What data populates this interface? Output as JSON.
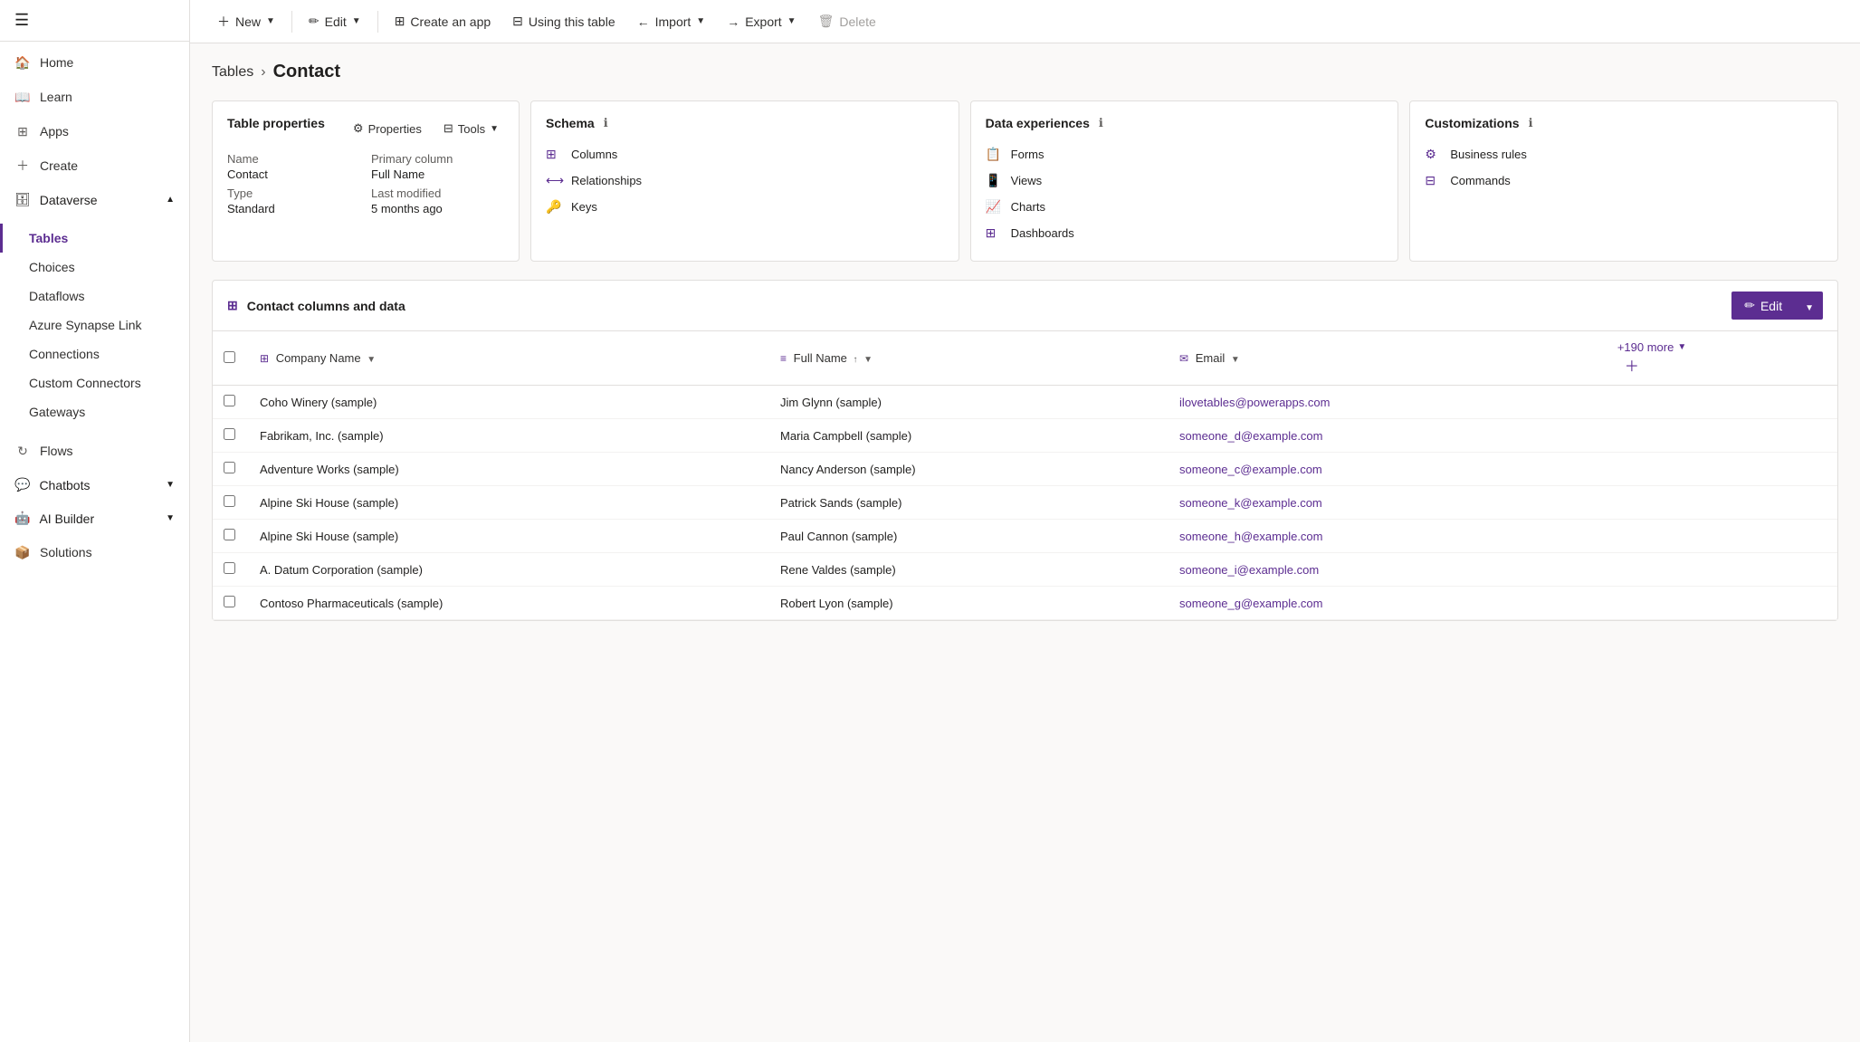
{
  "sidebar": {
    "items": [
      {
        "id": "home",
        "label": "Home",
        "icon": "🏠"
      },
      {
        "id": "learn",
        "label": "Learn",
        "icon": "📖"
      },
      {
        "id": "apps",
        "label": "Apps",
        "icon": "⊞"
      },
      {
        "id": "create",
        "label": "Create",
        "icon": "+"
      },
      {
        "id": "dataverse",
        "label": "Dataverse",
        "icon": "🗄",
        "expandable": true,
        "expanded": true
      }
    ],
    "dataverse_children": [
      {
        "id": "tables",
        "label": "Tables",
        "active": true
      },
      {
        "id": "choices",
        "label": "Choices"
      },
      {
        "id": "dataflows",
        "label": "Dataflows"
      },
      {
        "id": "azure-synapse-link",
        "label": "Azure Synapse Link"
      },
      {
        "id": "connections",
        "label": "Connections"
      },
      {
        "id": "custom-connectors",
        "label": "Custom Connectors"
      },
      {
        "id": "gateways",
        "label": "Gateways"
      }
    ],
    "bottom_items": [
      {
        "id": "flows",
        "label": "Flows",
        "icon": "↻"
      },
      {
        "id": "chatbots",
        "label": "Chatbots",
        "icon": "💬",
        "expandable": true
      },
      {
        "id": "ai-builder",
        "label": "AI Builder",
        "icon": "🤖",
        "expandable": true
      },
      {
        "id": "solutions",
        "label": "Solutions",
        "icon": "📦"
      }
    ]
  },
  "toolbar": {
    "new_label": "New",
    "edit_label": "Edit",
    "create_app_label": "Create an app",
    "using_table_label": "Using this table",
    "import_label": "Import",
    "export_label": "Export",
    "delete_label": "Delete"
  },
  "breadcrumb": {
    "parent": "Tables",
    "current": "Contact"
  },
  "table_properties_card": {
    "title": "Table properties",
    "properties_btn": "Properties",
    "tools_btn": "Tools",
    "name_label": "Name",
    "name_value": "Contact",
    "type_label": "Type",
    "type_value": "Standard",
    "primary_column_label": "Primary column",
    "primary_column_value": "Full Name",
    "last_modified_label": "Last modified",
    "last_modified_value": "5 months ago"
  },
  "schema_card": {
    "title": "Schema",
    "items": [
      {
        "id": "columns",
        "label": "Columns",
        "icon": "⊞"
      },
      {
        "id": "relationships",
        "label": "Relationships",
        "icon": "⟷"
      },
      {
        "id": "keys",
        "label": "Keys",
        "icon": "🔑"
      }
    ]
  },
  "data_experiences_card": {
    "title": "Data experiences",
    "items": [
      {
        "id": "forms",
        "label": "Forms",
        "icon": "📋"
      },
      {
        "id": "views",
        "label": "Views",
        "icon": "📱"
      },
      {
        "id": "charts",
        "label": "Charts",
        "icon": "📈"
      },
      {
        "id": "dashboards",
        "label": "Dashboards",
        "icon": "⊞"
      }
    ]
  },
  "customizations_card": {
    "title": "Customizations",
    "items": [
      {
        "id": "business-rules",
        "label": "Business rules",
        "icon": "⚙"
      },
      {
        "id": "commands",
        "label": "Commands",
        "icon": "⊟"
      }
    ]
  },
  "data_table": {
    "title": "Contact columns and data",
    "edit_label": "Edit",
    "columns": [
      {
        "id": "company",
        "label": "Company Name",
        "icon": "⊞"
      },
      {
        "id": "fullname",
        "label": "Full Name",
        "icon": "≡",
        "sorted": true,
        "sort_dir": "↑"
      },
      {
        "id": "email",
        "label": "Email",
        "icon": "✉"
      }
    ],
    "more_columns": "+190 more",
    "rows": [
      {
        "company": "Coho Winery (sample)",
        "fullname": "Jim Glynn (sample)",
        "email": "ilovetables@powerapps.com"
      },
      {
        "company": "Fabrikam, Inc. (sample)",
        "fullname": "Maria Campbell (sample)",
        "email": "someone_d@example.com"
      },
      {
        "company": "Adventure Works (sample)",
        "fullname": "Nancy Anderson (sample)",
        "email": "someone_c@example.com"
      },
      {
        "company": "Alpine Ski House (sample)",
        "fullname": "Patrick Sands (sample)",
        "email": "someone_k@example.com"
      },
      {
        "company": "Alpine Ski House (sample)",
        "fullname": "Paul Cannon (sample)",
        "email": "someone_h@example.com"
      },
      {
        "company": "A. Datum Corporation (sample)",
        "fullname": "Rene Valdes (sample)",
        "email": "someone_i@example.com"
      },
      {
        "company": "Contoso Pharmaceuticals (sample)",
        "fullname": "Robert Lyon (sample)",
        "email": "someone_g@example.com"
      }
    ]
  },
  "colors": {
    "primary": "#5c2d91",
    "primary_dark": "#491f74",
    "border": "#e1dfdd",
    "text": "#201f1e",
    "muted": "#605e5c"
  }
}
